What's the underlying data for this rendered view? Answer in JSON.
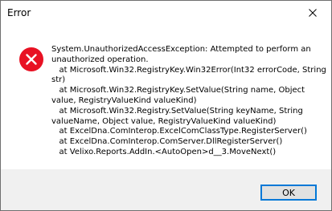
{
  "window": {
    "title": "Error"
  },
  "icons": {
    "close": "close-icon",
    "error": "error-icon"
  },
  "colors": {
    "error_icon_fill": "#e81123",
    "button_border": "#0078d7",
    "footer_background": "#f0f0f0"
  },
  "message": {
    "text": "System.UnauthorizedAccessException: Attempted to perform an unauthorized operation.\n   at Microsoft.Win32.RegistryKey.Win32Error(Int32 errorCode, String str)\n   at Microsoft.Win32.RegistryKey.SetValue(String name, Object value, RegistryValueKind valueKind)\n   at Microsoft.Win32.Registry.SetValue(String keyName, String valueName, Object value, RegistryValueKind valueKind)\n   at ExcelDna.ComInterop.ExcelComClassType.RegisterServer()\n   at ExcelDna.ComInterop.ComServer.DllRegisterServer()\n   at Velixo.Reports.AddIn.<AutoOpen>d__3.MoveNext()"
  },
  "buttons": {
    "ok_label": "OK"
  }
}
